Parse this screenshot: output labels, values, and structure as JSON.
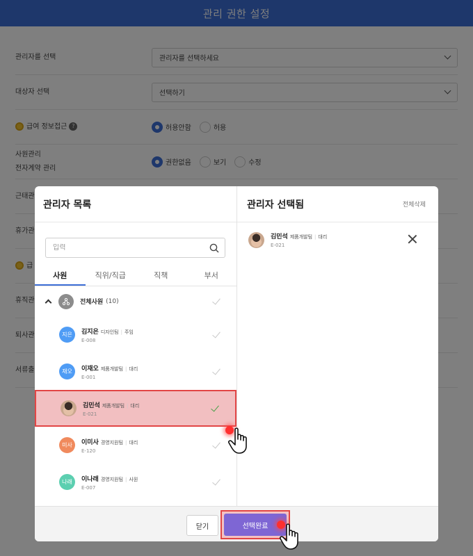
{
  "page": {
    "title": "관리 권한 설정",
    "rows": [
      {
        "label": "관리자를 선택",
        "select": "관리자를 선택하세요"
      },
      {
        "label": "대상자 선택",
        "select": "선택하기"
      }
    ],
    "pay_row": {
      "label": "급여 정보접근",
      "opt_on": "허용안함",
      "opt_off": "허용"
    },
    "staff_row": {
      "label1": "사원관리",
      "label2": "전자계약 관리",
      "opt1": "권한없음",
      "opt2": "보기",
      "opt3": "수정"
    },
    "hidden_labels": [
      "근태관",
      "휴가관",
      "급",
      "휴직관",
      "퇴사관",
      "서류출"
    ]
  },
  "modal": {
    "left_title": "관리자 목록",
    "right_title": "관리자 선택됨",
    "clear_all": "전체삭제",
    "search_placeholder": "입력",
    "tabs": [
      "사원",
      "직위/직급",
      "직책",
      "부서"
    ],
    "group": {
      "name": "전체사원",
      "count": "(10)"
    },
    "employees": [
      {
        "avatar": "지은",
        "name": "김지은",
        "dept": "디자인팀",
        "role": "주임",
        "code": "E-008",
        "color": "#4f9cf5"
      },
      {
        "avatar": "재오",
        "name": "이재오",
        "dept": "제품개발팀",
        "role": "대리",
        "code": "E-001",
        "color": "#4f9cf5"
      },
      {
        "avatar": "",
        "name": "김민석",
        "dept": "제품개발팀",
        "role": "대리",
        "code": "E-021",
        "color": "#c9a78e"
      },
      {
        "avatar": "미사",
        "name": "이미사",
        "dept": "경영지원팀",
        "role": "대리",
        "code": "E-120",
        "color": "#f08a5d"
      },
      {
        "avatar": "나래",
        "name": "이나래",
        "dept": "경영지원팀",
        "role": "사원",
        "code": "E-007",
        "color": "#5ccfb0"
      }
    ],
    "selected": {
      "name": "김민석",
      "dept": "제품개발팀",
      "role": "대리",
      "code": "E-021"
    },
    "close_label": "닫기",
    "done_label": "선택완료"
  }
}
